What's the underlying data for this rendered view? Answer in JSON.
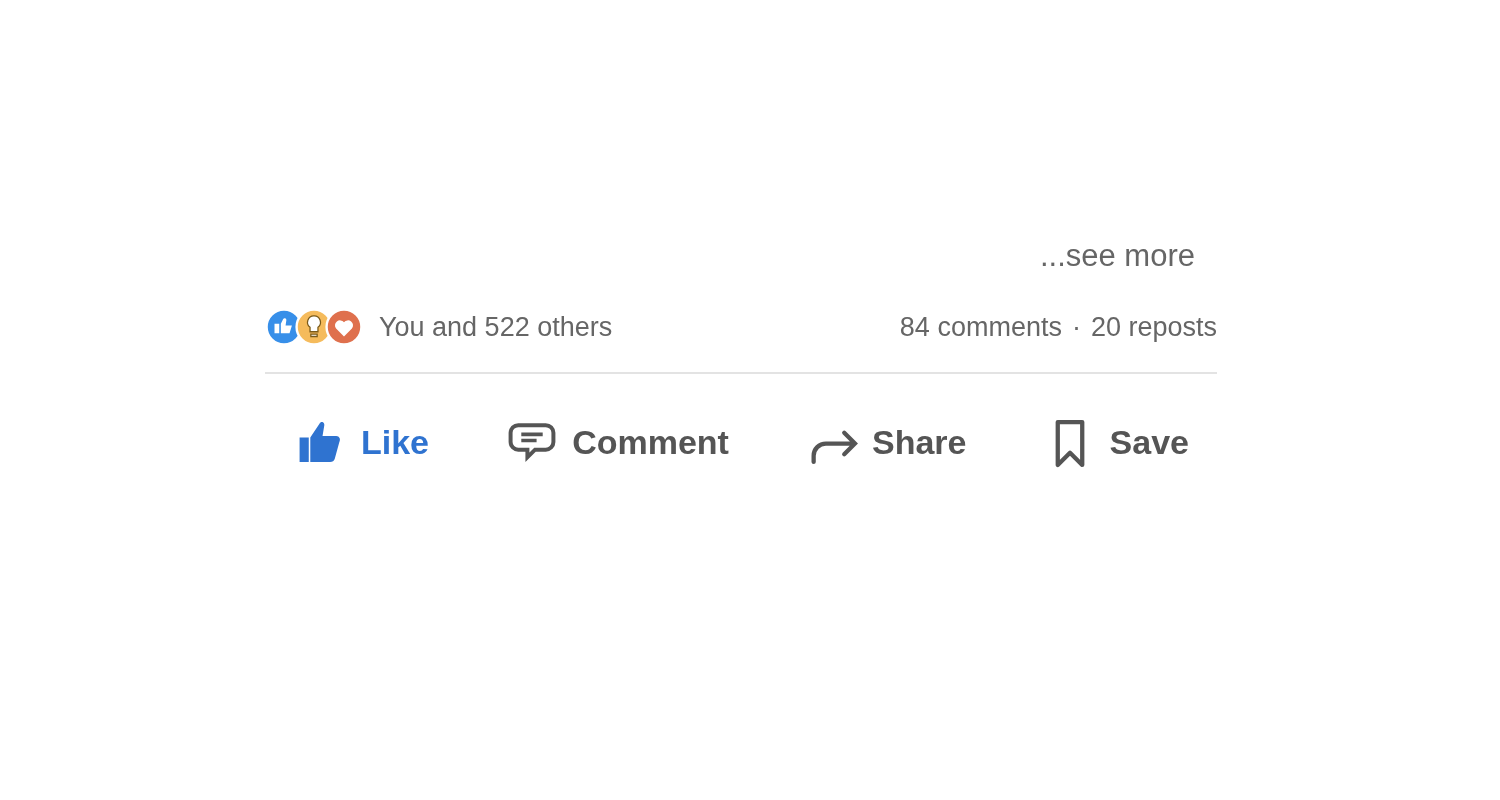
{
  "post": {
    "see_more": "...see more",
    "reactions": [
      {
        "kind": "like",
        "color": "#378fe9"
      },
      {
        "kind": "insightful",
        "color": "#f5bb5c"
      },
      {
        "kind": "love",
        "color": "#df704d"
      }
    ],
    "reaction_summary": "You and 522 others",
    "comments": "84 comments",
    "separator": "·",
    "reposts": "20 reposts",
    "actions": [
      {
        "kind": "like",
        "label": "Like",
        "selected": true
      },
      {
        "kind": "comment",
        "label": "Comment",
        "selected": false
      },
      {
        "kind": "share",
        "label": "Share",
        "selected": false
      },
      {
        "kind": "save",
        "label": "Save",
        "selected": false
      }
    ]
  }
}
